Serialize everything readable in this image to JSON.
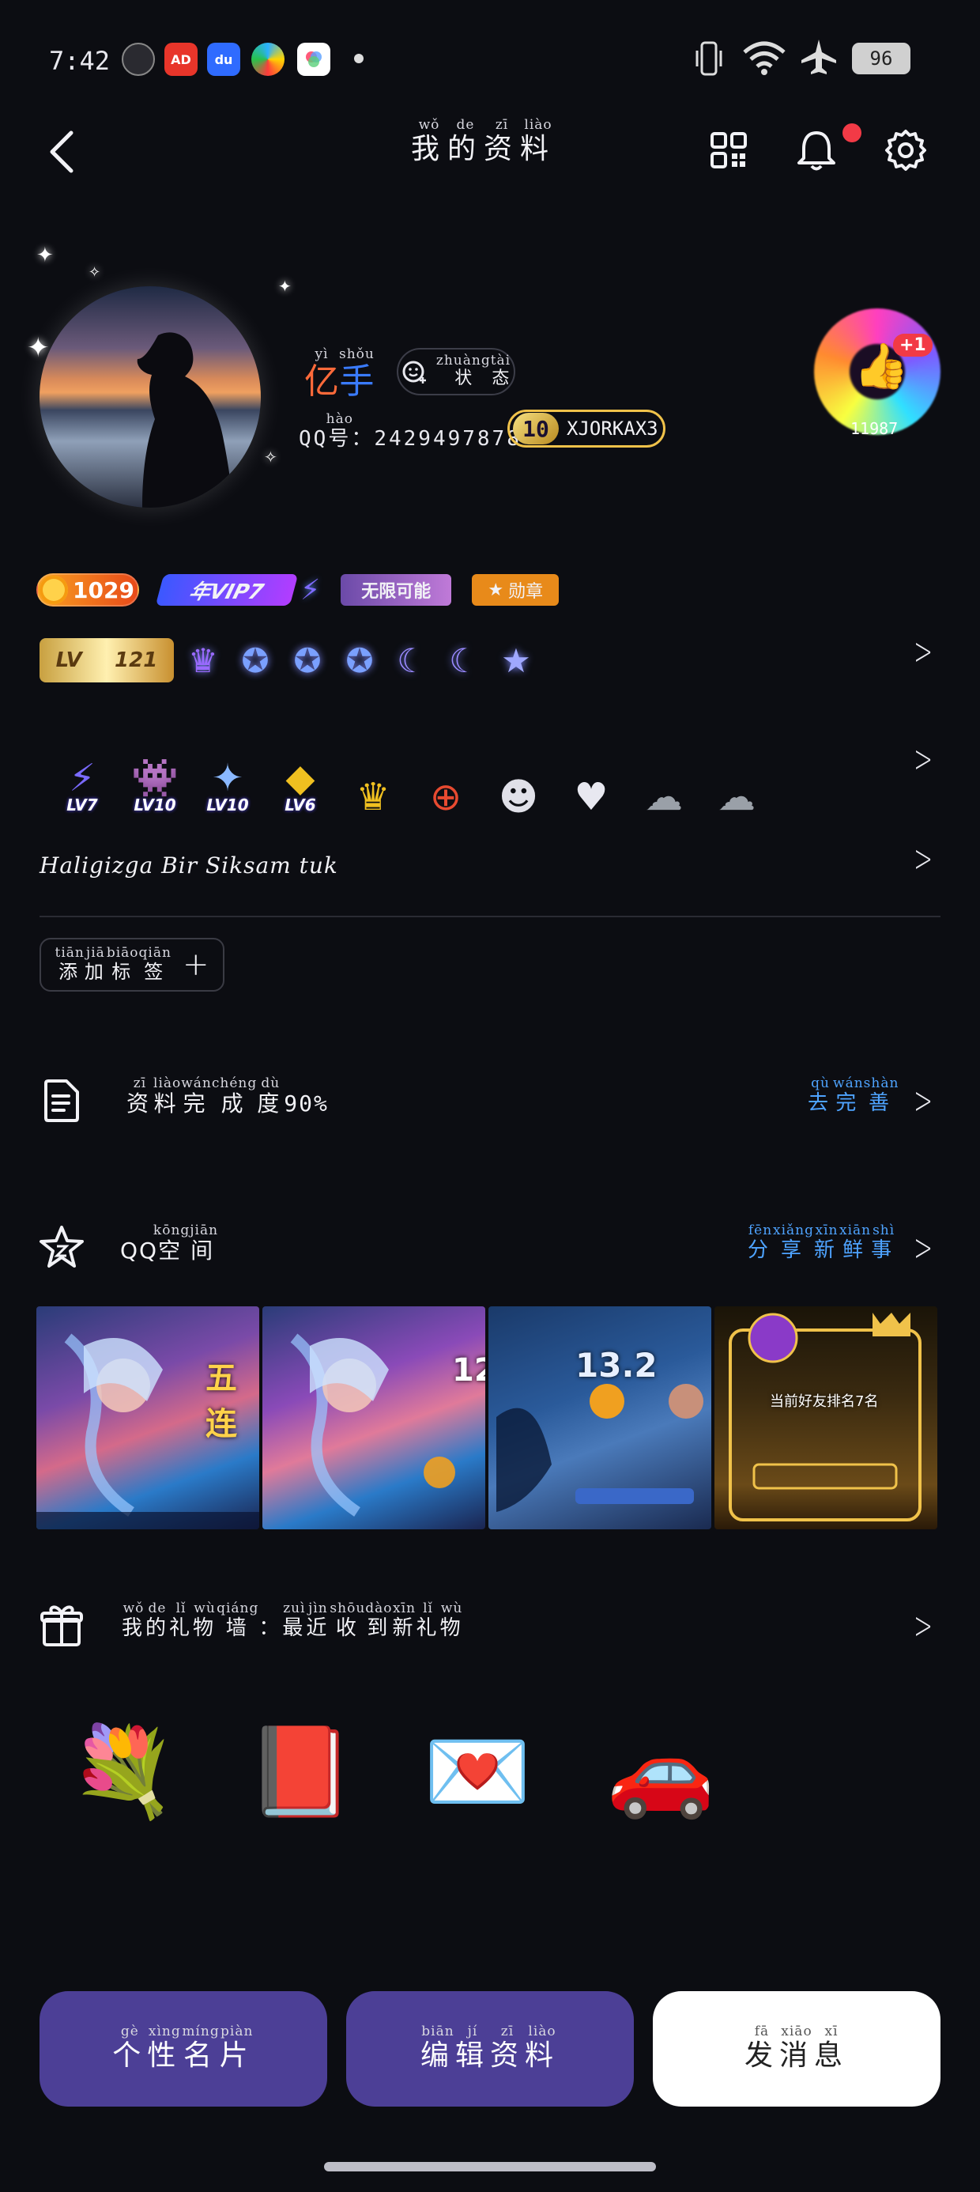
{
  "statusbar": {
    "time": "7:42",
    "battery": "96",
    "apps": [
      "AD",
      "du",
      "",
      ""
    ]
  },
  "header": {
    "title_chars": [
      {
        "c": "我",
        "p": "wǒ"
      },
      {
        "c": "的",
        "p": "de"
      },
      {
        "c": "资",
        "p": "zī"
      },
      {
        "c": "料",
        "p": "liào"
      }
    ]
  },
  "profile": {
    "nickname_chars": [
      {
        "c": "亿",
        "p": "yì"
      },
      {
        "c": "手",
        "p": "shǒu"
      }
    ],
    "status_chars": [
      {
        "c": "状",
        "p": "zhuàng"
      },
      {
        "c": "态",
        "p": "tài"
      }
    ],
    "qq_label_char": {
      "c": "号",
      "p": "hào"
    },
    "qq_prefix": "QQ",
    "qq_number": "：2429497878",
    "level_num": "10",
    "level_name": "XJORKAX3",
    "likes_plus": "+1",
    "likes_count": "11987"
  },
  "badges_row1": {
    "coin_value": "1029",
    "vip_label": "年VIP7",
    "wuxian_label": "无限可能",
    "xunzhang_label": "勋章"
  },
  "badges_row2": {
    "lv_prefix": "LV",
    "lv_num": "121"
  },
  "game_icons": [
    {
      "icon": "⚡",
      "lv": "LV7"
    },
    {
      "icon": "👾",
      "lv": "LV10"
    },
    {
      "icon": "✦",
      "lv": "LV10"
    },
    {
      "icon": "◆",
      "lv": "LV6"
    },
    {
      "icon": "♛",
      "lv": ""
    },
    {
      "icon": "⊕",
      "lv": ""
    },
    {
      "icon": "☻",
      "lv": ""
    },
    {
      "icon": "♥",
      "lv": ""
    },
    {
      "icon": "☁",
      "lv": ""
    },
    {
      "icon": "☁",
      "lv": ""
    }
  ],
  "signature": "Haligizga Bir Siksam tuk",
  "tags": {
    "add_tag_chars": [
      {
        "c": "添",
        "p": "tiān"
      },
      {
        "c": "加",
        "p": "jiā"
      },
      {
        "c": "标",
        "p": "biāo"
      },
      {
        "c": "签",
        "p": "qiān"
      }
    ]
  },
  "completion": {
    "title_chars": [
      {
        "c": "资",
        "p": "zī"
      },
      {
        "c": "料",
        "p": "liào"
      },
      {
        "c": "完",
        "p": "wán"
      },
      {
        "c": "成",
        "p": "chéng"
      },
      {
        "c": "度",
        "p": "dù"
      }
    ],
    "percent": "90%",
    "link_chars": [
      {
        "c": "去",
        "p": "qù"
      },
      {
        "c": "完",
        "p": "wán"
      },
      {
        "c": "善",
        "p": "shàn"
      }
    ]
  },
  "qzone": {
    "prefix": "QQ",
    "title_chars": [
      {
        "c": "空",
        "p": "kōng"
      },
      {
        "c": "间",
        "p": "jiān"
      }
    ],
    "link_chars": [
      {
        "c": "分",
        "p": "fēn"
      },
      {
        "c": "享",
        "p": "xiǎng"
      },
      {
        "c": "新",
        "p": "xīn"
      },
      {
        "c": "鲜",
        "p": "xiān"
      },
      {
        "c": "事",
        "p": "shì"
      }
    ],
    "photo_texts": [
      "五连",
      "12",
      "13.2",
      "当前好友排名7名"
    ]
  },
  "gifts": {
    "title_chars": [
      {
        "c": "我",
        "p": "wǒ"
      },
      {
        "c": "的",
        "p": "de"
      },
      {
        "c": "礼",
        "p": "lǐ"
      },
      {
        "c": "物",
        "p": "wù"
      },
      {
        "c": "墙",
        "p": "qiáng"
      },
      {
        "c": "：",
        "p": ""
      },
      {
        "c": "最",
        "p": "zuì"
      },
      {
        "c": "近",
        "p": "jìn"
      },
      {
        "c": "收",
        "p": "shōu"
      },
      {
        "c": "到",
        "p": "dào"
      },
      {
        "c": "新",
        "p": "xīn"
      },
      {
        "c": "礼",
        "p": "lǐ"
      },
      {
        "c": "物",
        "p": "wù"
      }
    ],
    "items": [
      "💐",
      "📕",
      "💌",
      "🚗"
    ]
  },
  "bottom_buttons": [
    {
      "chars": [
        {
          "c": "个",
          "p": "gè"
        },
        {
          "c": "性",
          "p": "xìng"
        },
        {
          "c": "名",
          "p": "míng"
        },
        {
          "c": "片",
          "p": "piàn"
        }
      ]
    },
    {
      "chars": [
        {
          "c": "编",
          "p": "biān"
        },
        {
          "c": "辑",
          "p": "jí"
        },
        {
          "c": "资",
          "p": "zī"
        },
        {
          "c": "料",
          "p": "liào"
        }
      ]
    },
    {
      "chars": [
        {
          "c": "发",
          "p": "fā"
        },
        {
          "c": "消",
          "p": "xiāo"
        },
        {
          "c": "息",
          "p": "xī"
        }
      ]
    }
  ],
  "colors": {
    "background": "#0c0d12",
    "accent_purple": "#4c3f96",
    "link_blue": "#4ea3ff",
    "notification_red": "#f23a46"
  },
  "icons": {
    "back": "chevron-left-icon",
    "qrcode": "qrcode-icon",
    "bell": "bell-icon",
    "settings": "gear-icon",
    "like": "thumbs-up-icon",
    "document": "document-icon",
    "star": "star-icon",
    "gift": "gift-icon"
  }
}
